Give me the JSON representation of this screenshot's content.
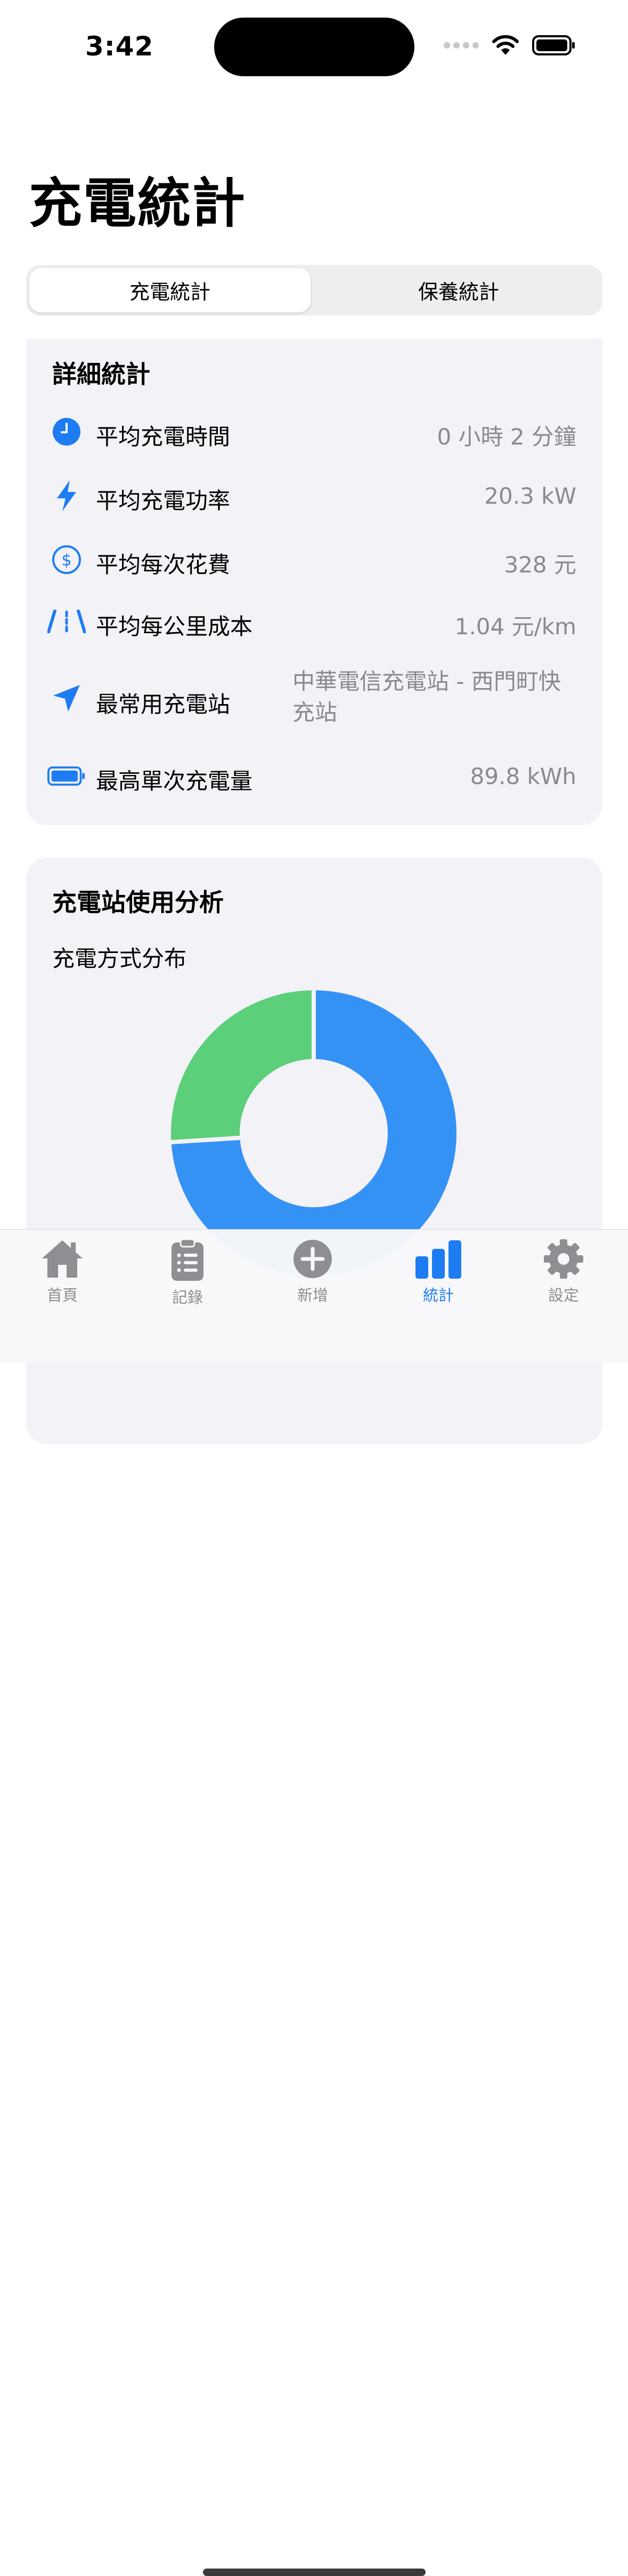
{
  "status_bar": {
    "time": "3:42"
  },
  "page": {
    "title": "充電統計"
  },
  "segmented": {
    "options": [
      "充電統計",
      "保養統計"
    ],
    "selected_index": 0
  },
  "details_card": {
    "title": "詳細統計",
    "rows": [
      {
        "icon": "clock-icon",
        "label": "平均充電時間",
        "value": "0 小時 2 分鐘"
      },
      {
        "icon": "bolt-icon",
        "label": "平均充電功率",
        "value": "20.3 kW"
      },
      {
        "icon": "dollar-circle-icon",
        "label": "平均每次花費",
        "value": "328 元"
      },
      {
        "icon": "road-icon",
        "label": "平均每公里成本",
        "value": "1.04 元/km"
      },
      {
        "icon": "location-arrow-icon",
        "label": "最常用充電站",
        "value": "中華電信充電站 - 西門町快充站"
      },
      {
        "icon": "battery-icon",
        "label": "最高單次充電量",
        "value": "89.8 kWh"
      }
    ]
  },
  "analysis_card": {
    "title": "充電站使用分析",
    "subtitle": "充電方式分布"
  },
  "chart_data": {
    "type": "pie",
    "variant": "donut",
    "slices": [
      {
        "value": 74,
        "color": "#3592f5"
      },
      {
        "value": 26,
        "color": "#5ccf7a"
      }
    ]
  },
  "tabbar": {
    "items": [
      {
        "icon": "house-icon",
        "label": "首頁"
      },
      {
        "icon": "clipboard-list-icon",
        "label": "記錄"
      },
      {
        "icon": "plus-circle-icon",
        "label": "新增"
      },
      {
        "icon": "bar-chart-icon",
        "label": "統計"
      },
      {
        "icon": "gear-icon",
        "label": "設定"
      }
    ],
    "active_index": 3
  },
  "colors": {
    "accent": "#1e7cf2",
    "card_bg": "#f2f2f7",
    "secondary_text": "#8a8a8e"
  }
}
